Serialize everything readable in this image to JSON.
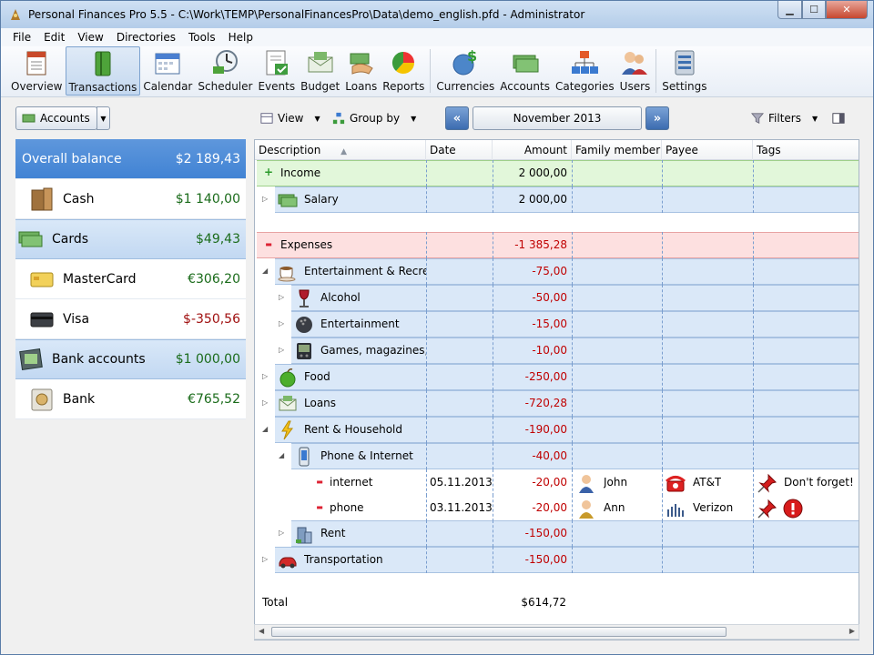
{
  "window": {
    "title": "Personal Finances Pro 5.5 - C:\\Work\\TEMP\\PersonalFinancesPro\\Data\\demo_english.pfd - Administrator",
    "btn_min": "▁",
    "btn_max": "☐",
    "btn_close": "✕"
  },
  "menu": [
    "File",
    "Edit",
    "View",
    "Directories",
    "Tools",
    "Help"
  ],
  "toolbar": [
    "Overview",
    "Transactions",
    "Calendar",
    "Scheduler",
    "Events",
    "Budget",
    "Loans",
    "Reports",
    "Currencies",
    "Accounts",
    "Categories",
    "Users",
    "Settings"
  ],
  "subbar": {
    "accounts": "Accounts",
    "view": "View",
    "group_by": "Group by",
    "month": "November 2013",
    "filters": "Filters"
  },
  "accounts": [
    {
      "name": "Overall balance",
      "amount": "$2 189,43",
      "kind": "top"
    },
    {
      "name": "Cash",
      "amount": "$1 140,00",
      "kind": "sub",
      "color": "#1a6b1a"
    },
    {
      "name": "Cards",
      "amount": "$49,43",
      "kind": "grp",
      "color": "#1a6b1a"
    },
    {
      "name": "MasterCard",
      "amount": "€306,20",
      "kind": "sub",
      "color": "#1a6b1a"
    },
    {
      "name": "Visa",
      "amount": "$-350,56",
      "kind": "sub",
      "color": "#a01010"
    },
    {
      "name": "Bank accounts",
      "amount": "$1 000,00",
      "kind": "grp",
      "color": "#1a6b1a"
    },
    {
      "name": "Bank",
      "amount": "€765,52",
      "kind": "sub",
      "color": "#1a6b1a"
    }
  ],
  "columns": [
    "Description",
    "Date",
    "Amount",
    "Family member",
    "Payee",
    "Tags"
  ],
  "rows": [
    {
      "desc": "Income",
      "amount": "2 000,00",
      "type": "income"
    },
    {
      "desc": "Salary",
      "amount": "2 000,00",
      "type": "cat",
      "level": 1
    },
    {
      "desc": "Expenses",
      "amount": "-1 385,28",
      "type": "expense"
    },
    {
      "desc": "Entertainment & Recre",
      "amount": "-75,00",
      "type": "cat",
      "level": 1,
      "open": true
    },
    {
      "desc": "Alcohol",
      "amount": "-50,00",
      "type": "cat",
      "level": 2
    },
    {
      "desc": "Entertainment",
      "amount": "-15,00",
      "type": "cat",
      "level": 2
    },
    {
      "desc": "Games, magazines,",
      "amount": "-10,00",
      "type": "cat",
      "level": 2
    },
    {
      "desc": "Food",
      "amount": "-250,00",
      "type": "cat",
      "level": 1
    },
    {
      "desc": "Loans",
      "amount": "-720,28",
      "type": "cat",
      "level": 1
    },
    {
      "desc": "Rent & Household",
      "amount": "-190,00",
      "type": "cat",
      "level": 1,
      "open": true
    },
    {
      "desc": "Phone & Internet",
      "amount": "-40,00",
      "type": "cat",
      "level": 2,
      "open": true
    },
    {
      "desc": "internet",
      "date": "05.11.2013",
      "amount": "-20,00",
      "member": "John",
      "payee": "AT&T",
      "tag": "Don't forget!",
      "type": "tx"
    },
    {
      "desc": "phone",
      "date": "03.11.2013",
      "amount": "-20,00",
      "member": "Ann",
      "payee": "Verizon",
      "type": "tx"
    },
    {
      "desc": "Rent",
      "amount": "-150,00",
      "type": "cat",
      "level": 2
    },
    {
      "desc": "Transportation",
      "amount": "-150,00",
      "type": "cat",
      "level": 1
    }
  ],
  "total": {
    "label": "Total",
    "amount": "$614,72"
  }
}
